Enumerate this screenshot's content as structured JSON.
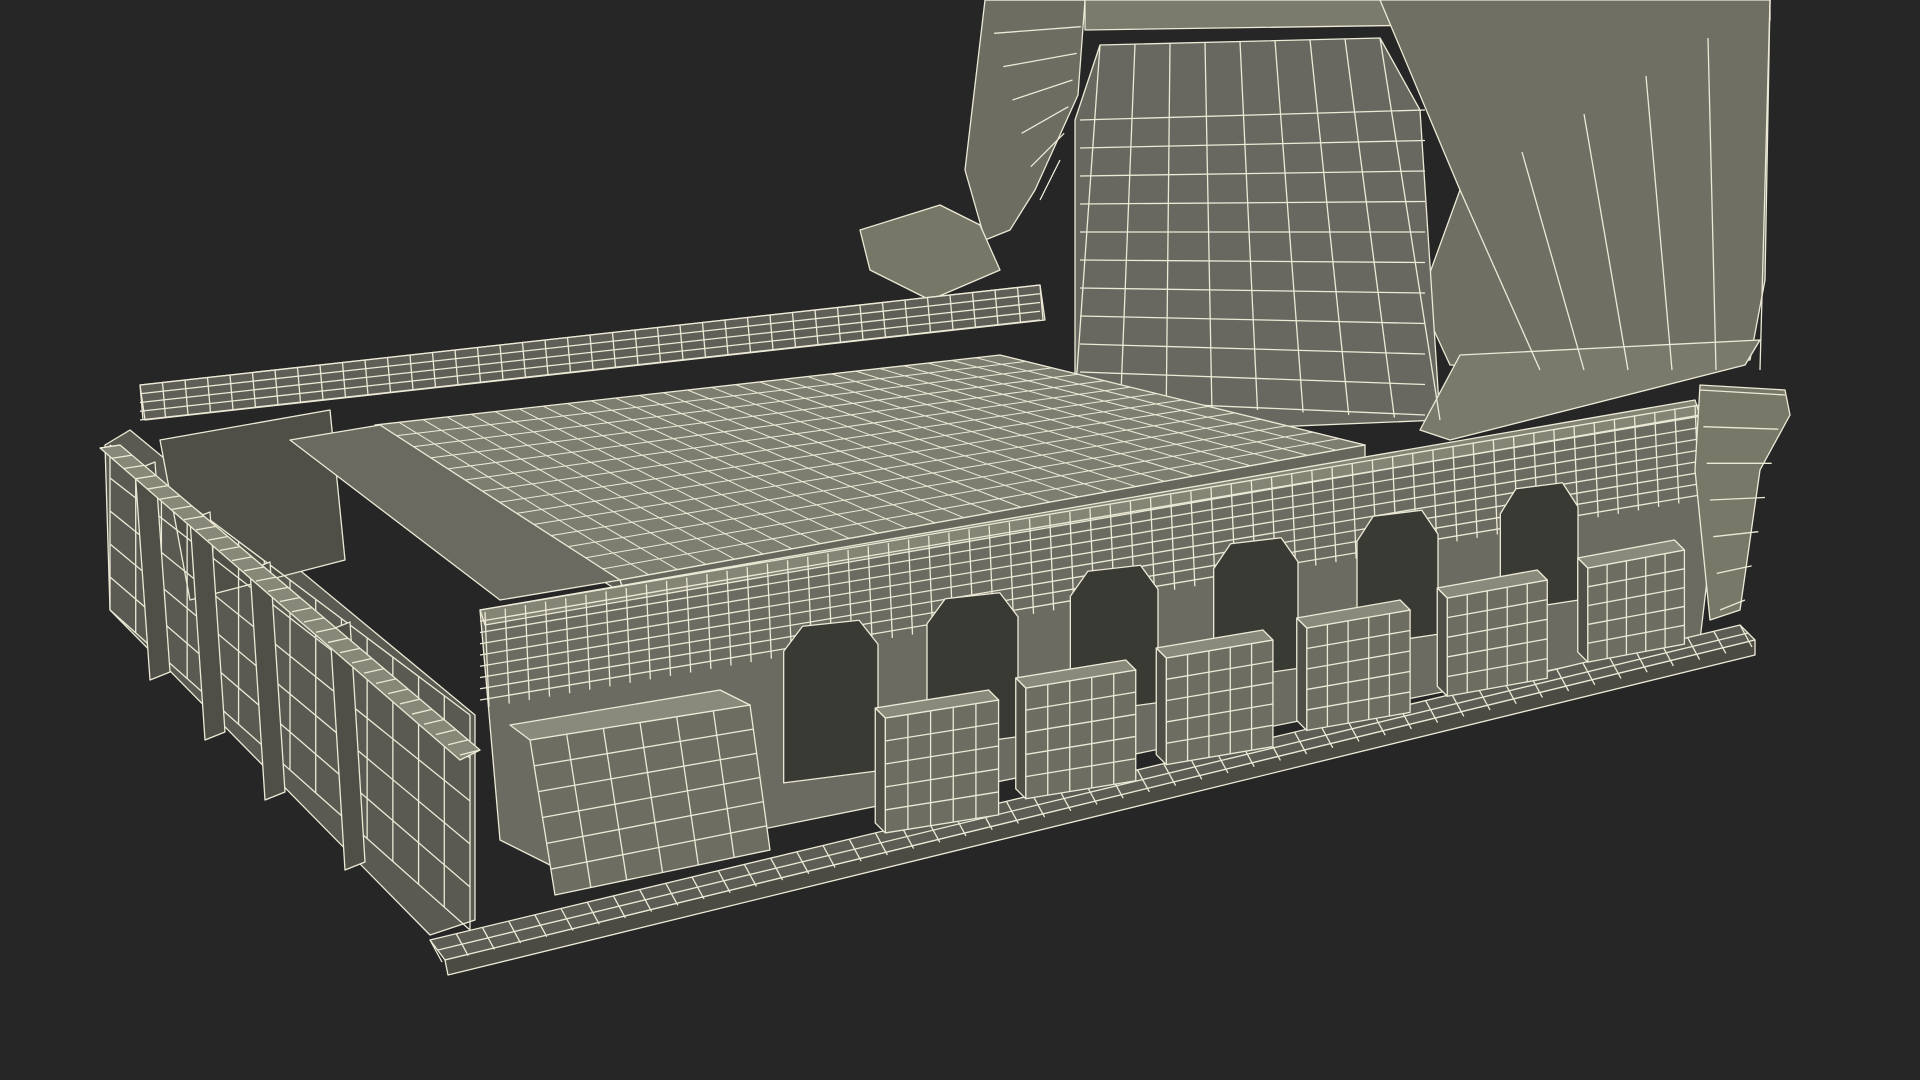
{
  "scene": {
    "subject": "wireframe-machine-base",
    "render_style": "wireframe",
    "colors": {
      "background": "#262626",
      "mesh_face": "#6d6d62",
      "mesh_face_light": "#8a8a7c",
      "mesh_face_dark": "#4f4f47",
      "wire": "#ecead6"
    },
    "counts": {
      "front_blocks": 6,
      "front_arches": 6,
      "table_grid_columns": 26,
      "table_grid_rows": 14
    }
  }
}
